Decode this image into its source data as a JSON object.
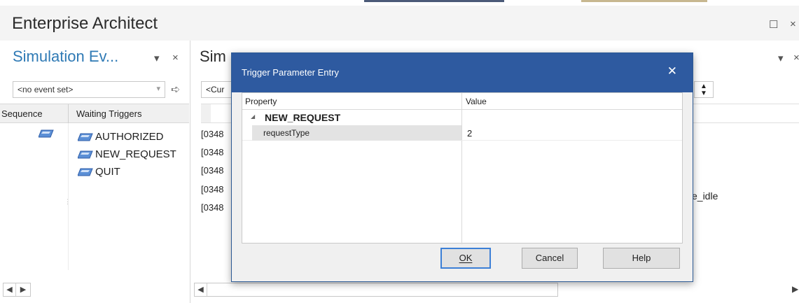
{
  "app": {
    "title": "Enterprise Architect"
  },
  "left_panel": {
    "title": "Simulation Ev...",
    "dropdown_glyph": "▾",
    "close_glyph": "×",
    "event_set": "<no event set>",
    "columns": [
      "Sequence",
      "Waiting Triggers"
    ],
    "triggers": [
      "AUTHORIZED",
      "NEW_REQUEST",
      "QUIT"
    ]
  },
  "right_panel": {
    "title": "Sim",
    "combo_value": "<Cur",
    "log_lines": [
      "[0348",
      "[0348",
      "[0348",
      "[0348",
      "[0348"
    ],
    "log_tail": "e_idle"
  },
  "dialog": {
    "title": "Trigger Parameter Entry",
    "close_glyph": "✕",
    "columns": {
      "property": "Property",
      "value": "Value"
    },
    "category": "NEW_REQUEST",
    "rows": [
      {
        "name": "requestType",
        "value": "2"
      }
    ],
    "buttons": {
      "ok": "OK",
      "cancel": "Cancel",
      "help": "Help"
    }
  },
  "colors": {
    "accent": "#2f7ab5",
    "dialog_title": "#2e5aa0",
    "trigger_icon": "#5b8fd6"
  },
  "icons": [
    "trigger-icon",
    "go-arrow-icon",
    "expand-triangle-icon",
    "close-icon",
    "scroll-left-icon",
    "scroll-right-icon"
  ]
}
